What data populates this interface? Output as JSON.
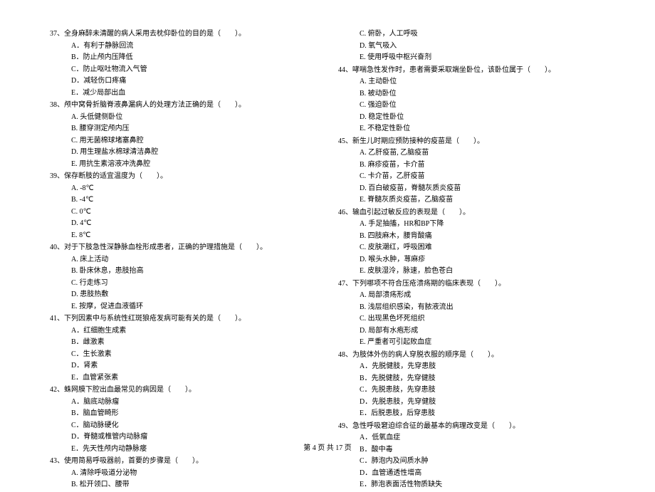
{
  "left_column": [
    {
      "title": "37、全身麻醉未清醒的病人采用去枕仰卧位的目的是（　　）。",
      "options": [
        "A．有利于静脉回流",
        "B．防止颅内压降低",
        "C．防止呕吐物流入气管",
        "D．减轻伤口疼痛",
        "E．减少局部出血"
      ]
    },
    {
      "title": "38、颅中窝骨折脑脊液鼻漏病人的处理方法正确的是（　　）。",
      "options": [
        "A. 头低健侧卧位",
        "B. 腰穿测定颅内压",
        "C. 用无菌棉球堵塞鼻腔",
        "D. 用生理盐水棉球清洁鼻腔",
        "E. 用抗生素溶液冲洗鼻腔"
      ]
    },
    {
      "title": "39、保存断肢的适宜温度为（　　）。",
      "options": [
        "A. -8℃",
        "B. -4℃",
        "C. 0℃",
        "D. 4℃",
        "E. 8℃"
      ]
    },
    {
      "title": "40、对于下肢急性深静脉血栓形成患者，正确的护理措施是（　　）。",
      "options": [
        "A. 床上活动",
        "B. 卧床休息，患肢抬高",
        "C. 行走练习",
        "D. 患肢热敷",
        "E. 按摩，促进血液循环"
      ]
    },
    {
      "title": "41、下列因素中与系统性红斑狼疮发病可能有关的是（　　）。",
      "options": [
        "A．红细胞生成素",
        "B．雌激素",
        "C．生长激素",
        "D．肾素",
        "E．血管紧张素"
      ]
    },
    {
      "title": "42、蛛网膜下腔出血最常见的病因是（　　）。",
      "options": [
        "A．脑底动脉瘤",
        "B．脑血管畸形",
        "C．脑动脉硬化",
        "D．脊髓或椎管内动脉瘤",
        "E．先天性颅内动静脉瘘"
      ]
    },
    {
      "title": "43、使用简易呼吸器前，首要的步骤是（　　）。",
      "options": [
        "A. 清除呼吸道分泌物",
        "B. 松开领口、腰带"
      ]
    }
  ],
  "right_column_start": [
    "C. 俯卧，人工呼吸",
    "D. 氧气吸入",
    "E. 使用呼吸中枢兴奋剂"
  ],
  "right_column": [
    {
      "title": "44、哮喘急性发作时，患者需要采取端坐卧位，该卧位属于（　　）。",
      "options": [
        "A. 主动卧位",
        "B. 被动卧位",
        "C. 强迫卧位",
        "D. 稳定性卧位",
        "E. 不稳定性卧位"
      ]
    },
    {
      "title": "45、新生儿时期应预防接种的疫苗是（　　）。",
      "options": [
        "A. 乙肝疫苗, 乙脑疫苗",
        "B. 麻疹疫苗，卡介苗",
        "C. 卡介苗，乙肝疫苗",
        "D. 百白破疫苗，脊髓灰质炎疫苗",
        "E. 脊髓灰质炎疫苗，乙脑疫苗"
      ]
    },
    {
      "title": "46、输血引起过敏反应的表现是（　　）。",
      "options": [
        "A. 手足抽搐，HR和BP下降",
        "B. 四肢麻木，腰背酸痛",
        "C. 皮肤潮红，呼吸困难",
        "D. 喉头水肿，荨麻疹",
        "E. 皮肤湿泠，脉速，脸色苍白"
      ]
    },
    {
      "title": "47、下列哪项不符合压疮溃疡期的临床表现（　　）。",
      "options": [
        "A. 局部溃疡形成",
        "B. 浅层组织感染，有脓液流出",
        "C. 出现黑色坏死组织",
        "D. 局部有水疱形成",
        "E. 严重者可引起败血症"
      ]
    },
    {
      "title": "48、为肢体外伤的病人穿脱衣服的顺序是（　　）。",
      "options": [
        "A．先脱健肢，先穿患肢",
        "B．先脱健肢，先穿健肢",
        "C．先脱患肢，先穿患肢",
        "D．先脱患肢，先穿健肢",
        "E．后脱患肢，后穿患肢"
      ]
    },
    {
      "title": "49、急性呼吸窘迫综合征的最基本的病理改变是（　　）。",
      "options": [
        "A．低氧血症",
        "B．酸中毒",
        "C．肺泡内及间质水肿",
        "D．血管通透性增高",
        "E．肺泡表面活性物质缺失"
      ]
    }
  ],
  "footer": "第 4 页 共 17 页"
}
